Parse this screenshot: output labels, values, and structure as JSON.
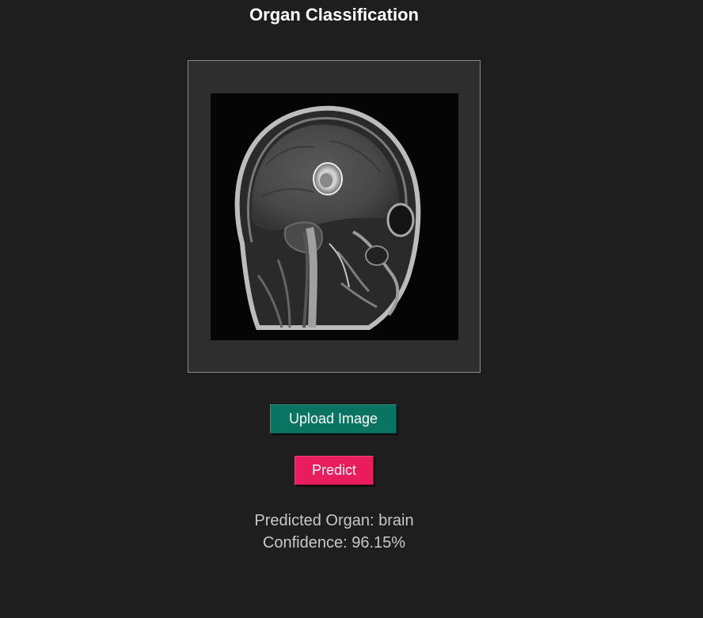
{
  "page": {
    "title": "Organ Classification"
  },
  "preview": {
    "image_subject": "sagittal brain MRI scan"
  },
  "buttons": {
    "upload_label": "Upload Image",
    "predict_label": "Predict"
  },
  "result": {
    "organ_text": "Predicted Organ: brain",
    "confidence_text": "Confidence: 96.15%"
  },
  "colors": {
    "background": "#1e1e1e",
    "frame": "#2e2e2e",
    "upload_button": "#087461",
    "predict_button": "#e91c5e",
    "result_text": "#c8c8c8"
  }
}
